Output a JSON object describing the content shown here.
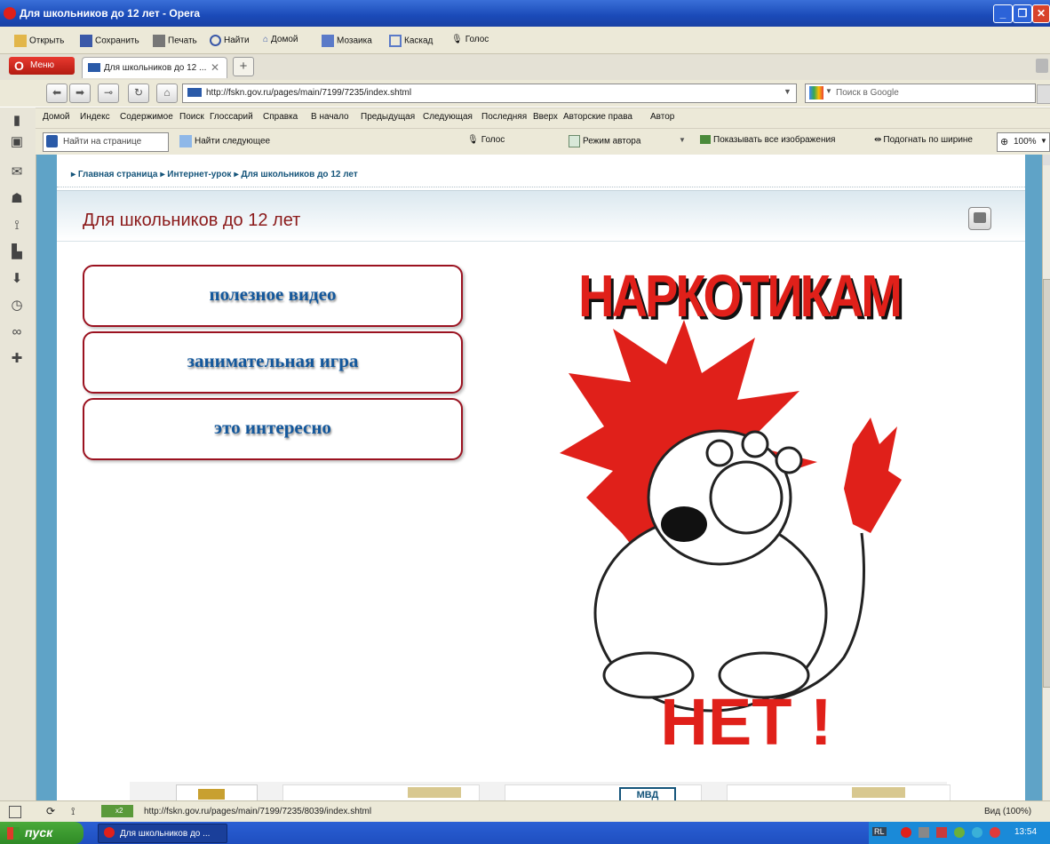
{
  "window": {
    "title": "Для школьников до 12 лет - Opera"
  },
  "menubar": {
    "items": [
      "Открыть",
      "Сохранить",
      "Печать",
      "Найти",
      "Домой",
      "Мозаика",
      "Каскад",
      "Голос"
    ]
  },
  "tabs": {
    "menu_label": "Меню",
    "active_tab": "Для школьников до 12 ..."
  },
  "address": {
    "url": "http://fskn.gov.ru/pages/main/7199/7235/index.shtml",
    "search_placeholder": "Поиск в Google"
  },
  "navbar": {
    "items": [
      "Домой",
      "Индекс",
      "Содержимое",
      "Поиск",
      "Глоссарий",
      "Справка",
      "В начало",
      "Предыдущая",
      "Следующая",
      "Последняя",
      "Вверх",
      "Авторские права",
      "Автор"
    ]
  },
  "findbar": {
    "find_placeholder": "Найти на странице",
    "find_next": "Найти следующее",
    "voice": "Голос",
    "author_mode": "Режим автора",
    "show_images": "Показывать все изображения",
    "fit_width": "Подогнать по ширине",
    "zoom": "100%"
  },
  "page": {
    "breadcrumbs": [
      "Главная страница",
      "Интернет-урок",
      "Для школьников до 12 лет"
    ],
    "title": "Для школьников до 12 лет",
    "buttons": [
      "полезное видео",
      "занимательная игра",
      "это интересно"
    ],
    "poster_top": "НАРКОТИКАМ",
    "poster_bottom": "НЕТ !",
    "banner_fragment": "МВД"
  },
  "statusbar": {
    "link_url": "http://fskn.gov.ru/pages/main/7199/7235/8039/index.shtml",
    "zoom_label": "Вид (100%)",
    "tab_count": "x2"
  },
  "taskbar": {
    "start_label": "пуск",
    "task_label": "Для школьников до ...",
    "lang": "RL",
    "clock": "13:54"
  },
  "colors": {
    "accent_red": "#e0201a",
    "heading_red": "#8b1a1a",
    "link_blue": "#14589c"
  }
}
